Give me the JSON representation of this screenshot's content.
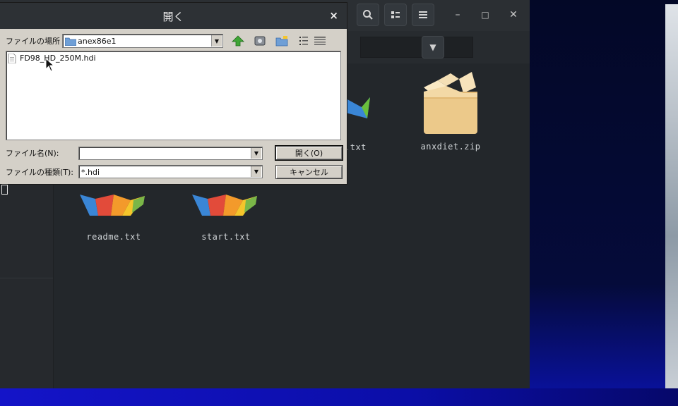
{
  "filemanager": {
    "files": [
      {
        "name": "anxdiet.zip",
        "kind": "archive"
      },
      {
        "name": "readme.txt",
        "kind": "text"
      },
      {
        "name": "start.txt",
        "kind": "text"
      },
      {
        "name": ".txt",
        "kind": "text"
      }
    ],
    "header_icons": [
      "search-icon",
      "view-toggle-icon",
      "menu-icon"
    ],
    "window_controls": {
      "minimize": "–",
      "maximize": "□",
      "close": "✕"
    }
  },
  "dialog": {
    "title": "開く",
    "close_glyph": "×",
    "location_label": "ファイルの場所",
    "location_value": "anex86e1",
    "toolbar_icons": [
      "up-folder-icon",
      "desktop-icon",
      "new-folder-icon",
      "list-view-icon",
      "details-view-icon"
    ],
    "files": [
      "FD98_HD_250M.hdi"
    ],
    "filename_label": "ファイル名(N):",
    "filename_value": "",
    "filetype_label": "ファイルの種類(T):",
    "filetype_value": "*.hdi",
    "open_button": "開く(O)",
    "cancel_button": "キャンセル"
  },
  "colors": {
    "dialog_bg": "#d4d0c8",
    "fm_bg": "#23272b",
    "title_bg": "#2d3135"
  }
}
